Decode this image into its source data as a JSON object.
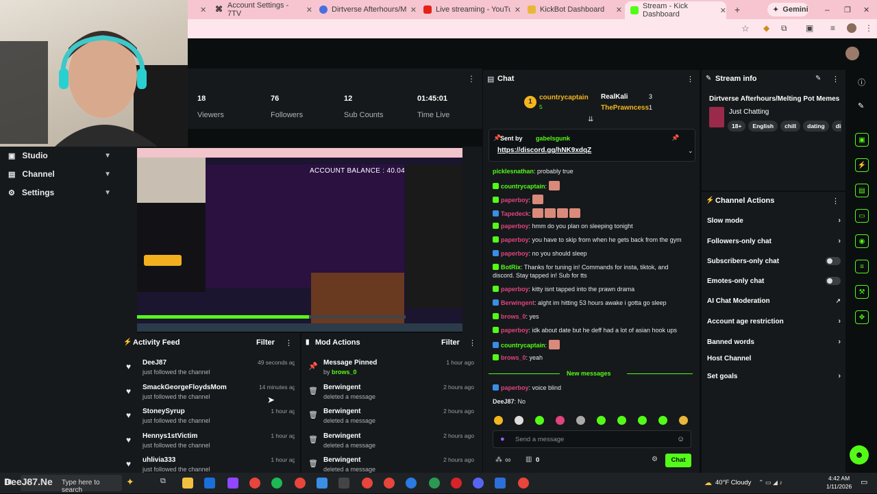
{
  "browser": {
    "tabs": [
      {
        "label": "Account Settings - 7TV",
        "color": "#2b2b2b"
      },
      {
        "label": "Dirtverse Afterhours/Melting",
        "color": "#4a6ee0"
      },
      {
        "label": "Live streaming - YouTube St",
        "color": "#e62117"
      },
      {
        "label": "KickBot Dashboard",
        "color": "#e8b73a"
      },
      {
        "label": "Stream - Kick Dashboard",
        "color": "#53fc18"
      }
    ],
    "gemini_label": "Gemini"
  },
  "stats": [
    {
      "value": "18",
      "label": "Viewers"
    },
    {
      "value": "76",
      "label": "Followers"
    },
    {
      "value": "12",
      "label": "Sub Counts"
    },
    {
      "value": "01:45:01",
      "label": "Time Live"
    }
  ],
  "nav": [
    {
      "label": "Studio"
    },
    {
      "label": "Channel"
    },
    {
      "label": "Settings"
    }
  ],
  "preview": {
    "overlay_text": "ACCOUNT BALANCE : 40.04"
  },
  "activity_feed": {
    "title": "Activity Feed",
    "filter": "Filter",
    "rows": [
      {
        "name": "DeeJ87",
        "sub": "just followed the channel",
        "time": "49 seconds ago"
      },
      {
        "name": "SmackGeorgeFloydsMom",
        "sub": "just followed the channel",
        "time": "14 minutes ago"
      },
      {
        "name": "StoneySyrup",
        "sub": "just followed the channel",
        "time": "1 hour ago"
      },
      {
        "name": "Hennys1stVictim",
        "sub": "just followed the channel",
        "time": "1 hour ago"
      },
      {
        "name": "uhlivia333",
        "sub": "just followed the channel",
        "time": "1 hour ago"
      }
    ]
  },
  "mod_actions": {
    "title": "Mod Actions",
    "filter": "Filter",
    "rows": [
      {
        "name": "Message Pinned",
        "sub_prefix": "by",
        "sub_user": "brows_0",
        "time": "1 hour ago"
      },
      {
        "name": "Berwingent",
        "sub": "deleted a message",
        "time": "2 hours ago"
      },
      {
        "name": "Berwingent",
        "sub": "deleted a message",
        "time": "2 hours ago"
      },
      {
        "name": "Berwingent",
        "sub": "deleted a message",
        "time": "2 hours ago"
      },
      {
        "name": "Berwingent",
        "sub": "deleted a message",
        "time": "2 hours ago"
      }
    ]
  },
  "chat": {
    "title": "Chat",
    "leaders": [
      {
        "rank": "1",
        "name": "countrycaptain",
        "count": "5"
      },
      {
        "name": "RealKali",
        "count": "3"
      },
      {
        "name": "ThePrawncess",
        "count": "1"
      }
    ],
    "pinned": {
      "sent_by_label": "Sent by",
      "sender": "gabelsgunk",
      "link": "https://discord.gg/hNK9xdqZ"
    },
    "messages": [
      {
        "user": "picklesnathan",
        "color": "#53fc18",
        "text": "probably true"
      },
      {
        "user": "countrycaptain",
        "color": "#53fc18",
        "text": ""
      },
      {
        "user": "paperboy",
        "color": "#e0447c",
        "text": ""
      },
      {
        "user": "Tapedeck",
        "color": "#e0447c",
        "text": ""
      },
      {
        "user": "paperboy",
        "color": "#e0447c",
        "text": "hmm do you plan on sleeping tonight"
      },
      {
        "user": "paperboy",
        "color": "#e0447c",
        "text": "you have to skip from when he gets back from the gym"
      },
      {
        "user": "paperboy",
        "color": "#e0447c",
        "text": "no you should sleep"
      },
      {
        "user": "BotRix",
        "color": "#53fc18",
        "text": "Thanks for tuning in! Commands for insta, tiktok, and discord. Stay tapped in! Sub for tts"
      },
      {
        "user": "paperboy",
        "color": "#e0447c",
        "text": "kitty isnt tapped into the prawn drama"
      },
      {
        "user": "Berwingent",
        "color": "#e0447c",
        "text": "alght im hitting 53 hours awake i gotta go sleep"
      },
      {
        "user": "brows_0",
        "color": "#e0447c",
        "text": "yes"
      },
      {
        "user": "paperboy",
        "color": "#e0447c",
        "text": "idk about date but he deff had a lot of asian hook ups"
      },
      {
        "user": "countrycaptain",
        "color": "#53fc18",
        "text": ""
      },
      {
        "user": "brows_0",
        "color": "#e0447c",
        "text": "yeah"
      }
    ],
    "new_messages": "New messages",
    "after": [
      {
        "user": "paperboy",
        "color": "#e0447c",
        "text": "voice blind"
      },
      {
        "user": "DeeJ87",
        "color": "#e8eaec",
        "text": "No"
      }
    ],
    "input_placeholder": "Send a message",
    "viewers_icon_text": "∞",
    "gift_count": "0",
    "send_label": "Chat"
  },
  "stream_info": {
    "title": "Stream info",
    "stream_title": "Dirtverse Afterhours/Melting Pot Memes",
    "category": "Just Chatting",
    "tags": [
      "18+",
      "English",
      "chill",
      "dating",
      "dir"
    ]
  },
  "channel_actions": {
    "title": "Channel Actions",
    "items": [
      {
        "label": "Slow mode",
        "control": "chevron"
      },
      {
        "label": "Followers-only chat",
        "control": "chevron"
      },
      {
        "label": "Subscribers-only chat",
        "control": "toggle"
      },
      {
        "label": "Emotes-only chat",
        "control": "toggle"
      },
      {
        "label": "AI Chat Moderation",
        "control": "external"
      },
      {
        "label": "Account age restriction",
        "control": "chevron"
      },
      {
        "label": "Banned words",
        "control": "chevron"
      },
      {
        "label": "Host Channel",
        "control": "none"
      },
      {
        "label": "Set goals",
        "control": "chevron"
      }
    ]
  },
  "taskbar": {
    "search_text": "Type here to search",
    "watermark": "DeeJ87.Ne",
    "weather": "40°F Cloudy",
    "time": "4:42 AM",
    "date": "1/11/2026"
  },
  "accent": "#53fc18"
}
